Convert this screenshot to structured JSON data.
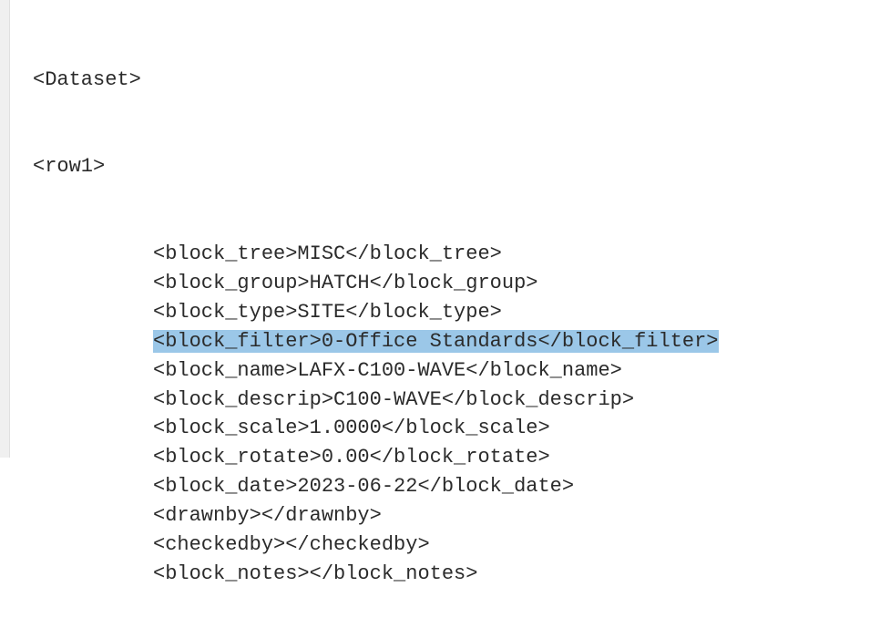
{
  "xml": {
    "dataset_open": "<Dataset>",
    "row1_open": "<row1>",
    "lines": [
      {
        "tag": "block_tree",
        "value": "MISC",
        "selected": false
      },
      {
        "tag": "block_group",
        "value": "HATCH",
        "selected": false
      },
      {
        "tag": "block_type",
        "value": "SITE",
        "selected": false
      },
      {
        "tag": "block_filter",
        "value": "0-Office Standards",
        "selected": true
      },
      {
        "tag": "block_name",
        "value": "LAFX-C100-WAVE",
        "selected": false
      },
      {
        "tag": "block_descrip",
        "value": "C100-WAVE",
        "selected": false
      },
      {
        "tag": "block_scale",
        "value": "1.0000",
        "selected": false
      },
      {
        "tag": "block_rotate",
        "value": "0.00",
        "selected": false
      },
      {
        "tag": "block_date",
        "value": "2023-06-22",
        "selected": false
      },
      {
        "tag": "drawnby",
        "value": "",
        "selected": false
      },
      {
        "tag": "checkedby",
        "value": "",
        "selected": false
      },
      {
        "tag": "block_notes",
        "value": "",
        "selected": false
      }
    ]
  }
}
